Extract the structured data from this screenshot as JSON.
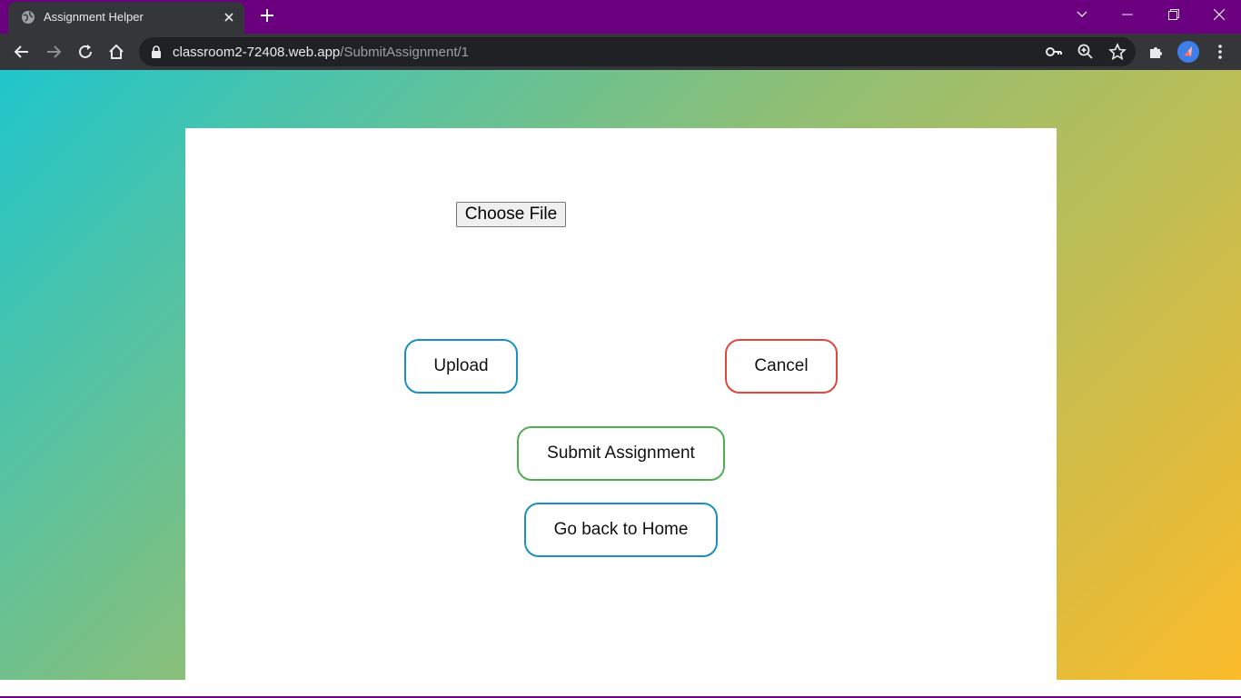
{
  "browser": {
    "tab_title": "Assignment Helper",
    "url_domain": "classroom2-72408.web.app",
    "url_path": "/SubmitAssignment/1",
    "frame_color": "#6a0080"
  },
  "form": {
    "file_button_label": "Choose File",
    "upload_label": "Upload",
    "cancel_label": "Cancel",
    "submit_label": "Submit Assignment",
    "home_label": "Go back to Home"
  },
  "colors": {
    "upload_border": "#1a8fc4",
    "cancel_border": "#e0473f",
    "submit_border": "#4caf50",
    "home_border": "#1a8fc4"
  },
  "icons": [
    "globe-icon",
    "close-icon",
    "plus-icon",
    "chevron-down-icon",
    "minimize-icon",
    "restore-icon",
    "window-close-icon",
    "back-arrow-icon",
    "forward-arrow-icon",
    "reload-icon",
    "home-icon",
    "lock-icon",
    "key-icon",
    "zoom-icon",
    "star-icon",
    "extensions-icon",
    "profile-avatar",
    "menu-dots-icon"
  ]
}
